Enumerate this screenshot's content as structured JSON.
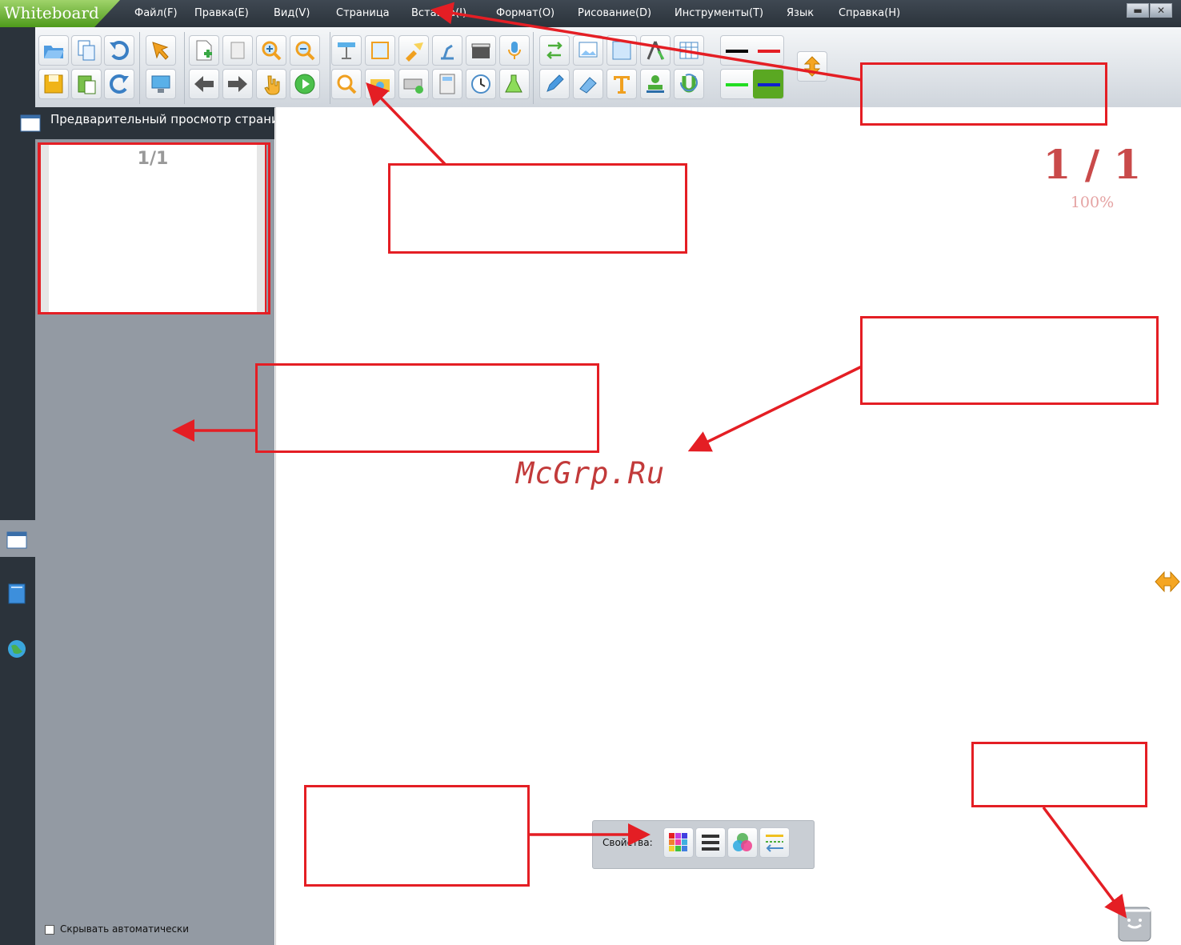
{
  "app": {
    "title": "Whiteboard"
  },
  "menu": [
    "Файл(F)",
    "Правка(E)",
    "Вид(V)",
    "Страница",
    "Вставка(I)",
    "Формат(O)",
    "Рисование(D)",
    "Инструменты(T)",
    "Язык",
    "Справка(H)"
  ],
  "window_controls": {
    "minimize": "▬",
    "close": "✕"
  },
  "preview": {
    "title": "Предварительный просмотр страниц",
    "thumb_label": "1/1",
    "autohide_label": "Скрывать автоматически"
  },
  "canvas": {
    "page_indicator": "1 / 1",
    "zoom": "100%",
    "watermark": "McGrp.Ru"
  },
  "properties": {
    "label": "Свойства:"
  },
  "colors": {
    "accent_red": "#e41e24",
    "brand_green": "#5aa822",
    "chrome_dark": "#2b333b"
  }
}
